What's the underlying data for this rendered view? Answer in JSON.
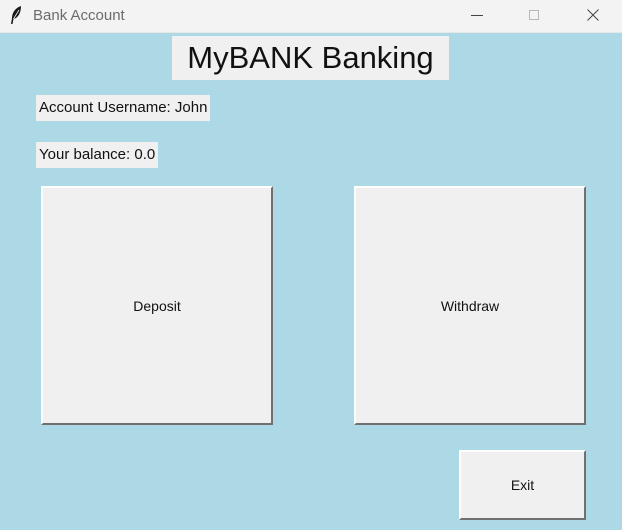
{
  "window": {
    "title": "Bank Account",
    "background_color": "#add8e6",
    "icon": "feather-icon"
  },
  "main": {
    "heading": "MyBANK Banking",
    "username_label": "Account Username: John",
    "balance_label": "Your balance: 0.0"
  },
  "buttons": {
    "deposit_label": "Deposit",
    "withdraw_label": "Withdraw",
    "exit_label": "Exit"
  }
}
